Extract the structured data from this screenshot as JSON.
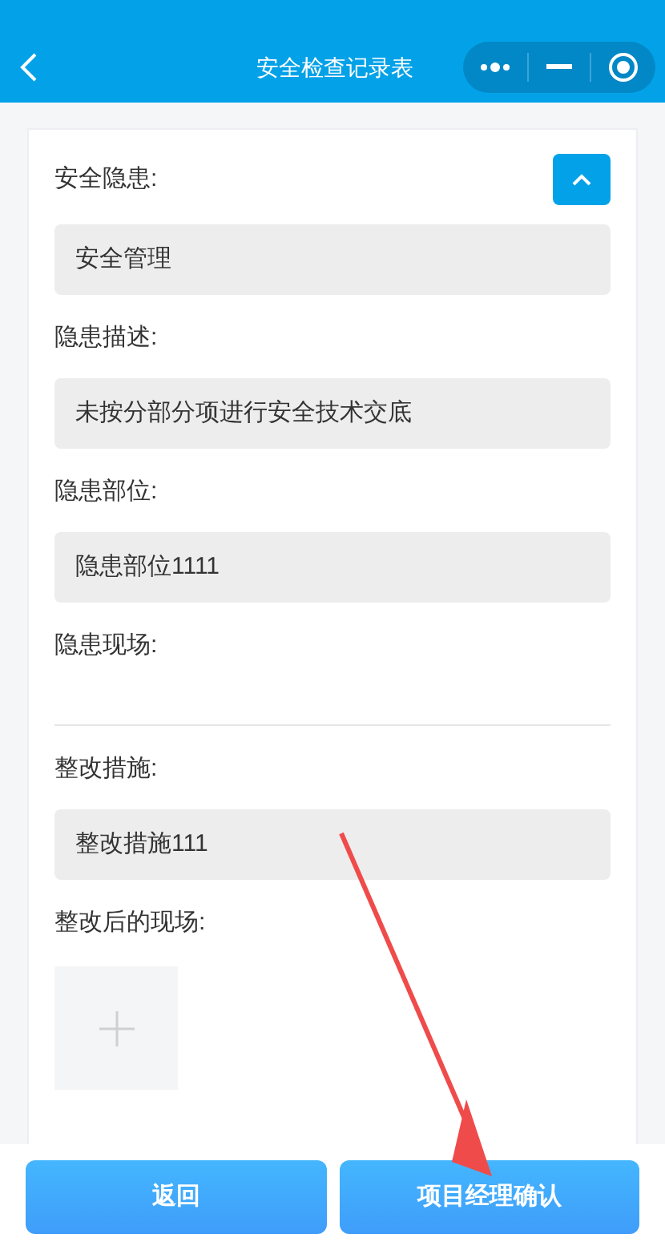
{
  "header": {
    "title": "安全检查记录表"
  },
  "card": {
    "expanded": true,
    "fields": [
      {
        "kind": "value",
        "label": "安全隐患:",
        "value": "安全管理"
      },
      {
        "kind": "value",
        "label": "隐患描述:",
        "value": "未按分部分项进行安全技术交底"
      },
      {
        "kind": "value",
        "label": "隐患部位:",
        "value": "隐患部位1111"
      },
      {
        "kind": "photos",
        "label": "隐患现场:"
      },
      {
        "kind": "value",
        "label": "整改措施:",
        "value": "整改措施111"
      },
      {
        "kind": "upload",
        "label": "整改后的现场:"
      }
    ]
  },
  "buttons": [
    {
      "label": "返回"
    },
    {
      "label": "项目经理确认"
    }
  ]
}
